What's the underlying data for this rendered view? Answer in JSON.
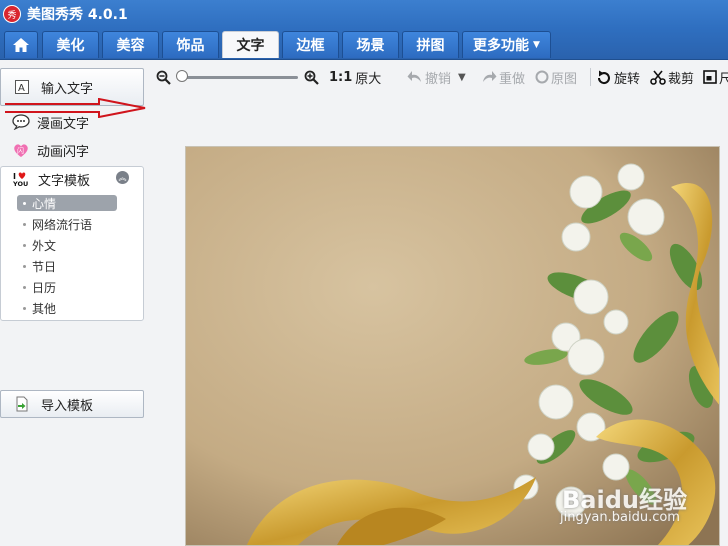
{
  "app": {
    "logo_char": "秀",
    "title": "美图秀秀 4.0.1"
  },
  "tabs": {
    "home": "home",
    "items": [
      {
        "label": "美化"
      },
      {
        "label": "美容"
      },
      {
        "label": "饰品"
      },
      {
        "label": "文字",
        "active": true
      },
      {
        "label": "边框"
      },
      {
        "label": "场景"
      },
      {
        "label": "拼图"
      },
      {
        "label": "更多功能"
      }
    ]
  },
  "sidebar": {
    "input_text": "输入文字",
    "comic_text": "漫画文字",
    "animated_text": "动画闪字",
    "template_title": "文字模板",
    "categories": [
      "心情",
      "网络流行语",
      "外文",
      "节日",
      "日历",
      "其他"
    ],
    "selected_category": "心情",
    "import_template": "导入模板"
  },
  "toolbar": {
    "ratio": "1:1",
    "original_size": "原大",
    "undo": "撤销",
    "redo": "重做",
    "original": "原图",
    "rotate": "旋转",
    "crop": "裁剪",
    "size": "尺"
  },
  "watermark": {
    "brand": "Baidu经验",
    "url": "jingyan.baidu.com"
  },
  "colors": {
    "titlebar": "#2f6fc0",
    "tab": "#3f86dd",
    "arrow": "#d0141c",
    "ribbon": "#d8a936",
    "paper": "#c9b38e"
  }
}
